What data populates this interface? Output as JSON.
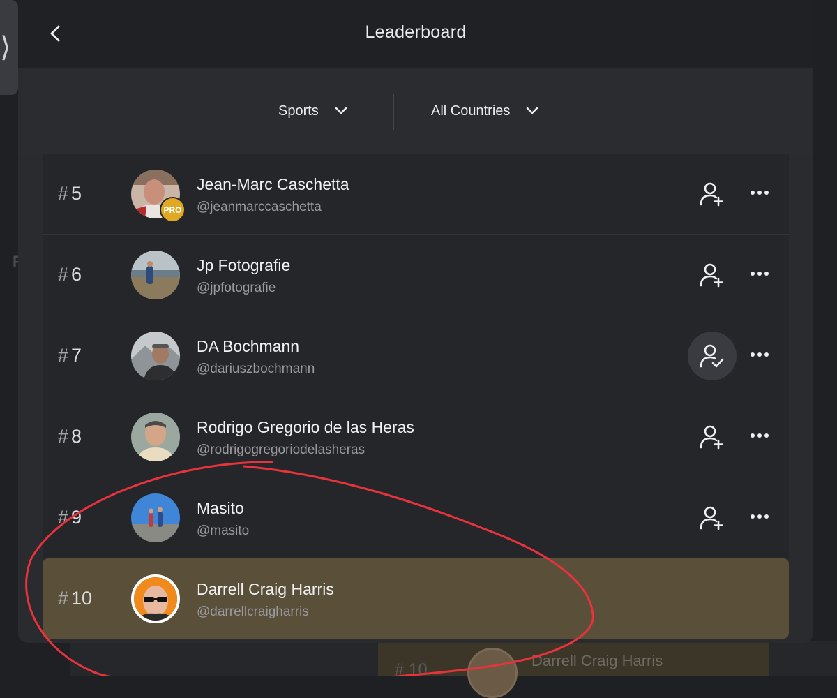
{
  "header": {
    "title": "Leaderboard"
  },
  "filters": {
    "category": "Sports",
    "country": "All Countries"
  },
  "background": {
    "sidebar_letter": "P",
    "peek_rank": "# 10",
    "peek_name": "Darrell Craig Harris"
  },
  "rows": [
    {
      "hash": "#",
      "rank": "5",
      "name": "Jean-Marc Caschetta",
      "handle": "@jeanmarccaschetta",
      "badge": "PRO",
      "following": false
    },
    {
      "hash": "#",
      "rank": "6",
      "name": "Jp Fotografie",
      "handle": "@jpfotografie",
      "following": false
    },
    {
      "hash": "#",
      "rank": "7",
      "name": "DA Bochmann",
      "handle": "@dariuszbochmann",
      "following": true
    },
    {
      "hash": "#",
      "rank": "8",
      "name": "Rodrigo Gregorio de las Heras",
      "handle": "@rodrigogregoriodelasheras",
      "following": false
    },
    {
      "hash": "#",
      "rank": "9",
      "name": "Masito",
      "handle": "@masito",
      "following": false
    },
    {
      "hash": "#",
      "rank": "10",
      "name": "Darrell Craig Harris",
      "handle": "@darrellcraigharris",
      "following": false,
      "current_user": true
    }
  ],
  "colors": {
    "highlight": "#5a4f39",
    "pro_badge": "#e0a823",
    "annotation": "#e8323c"
  }
}
